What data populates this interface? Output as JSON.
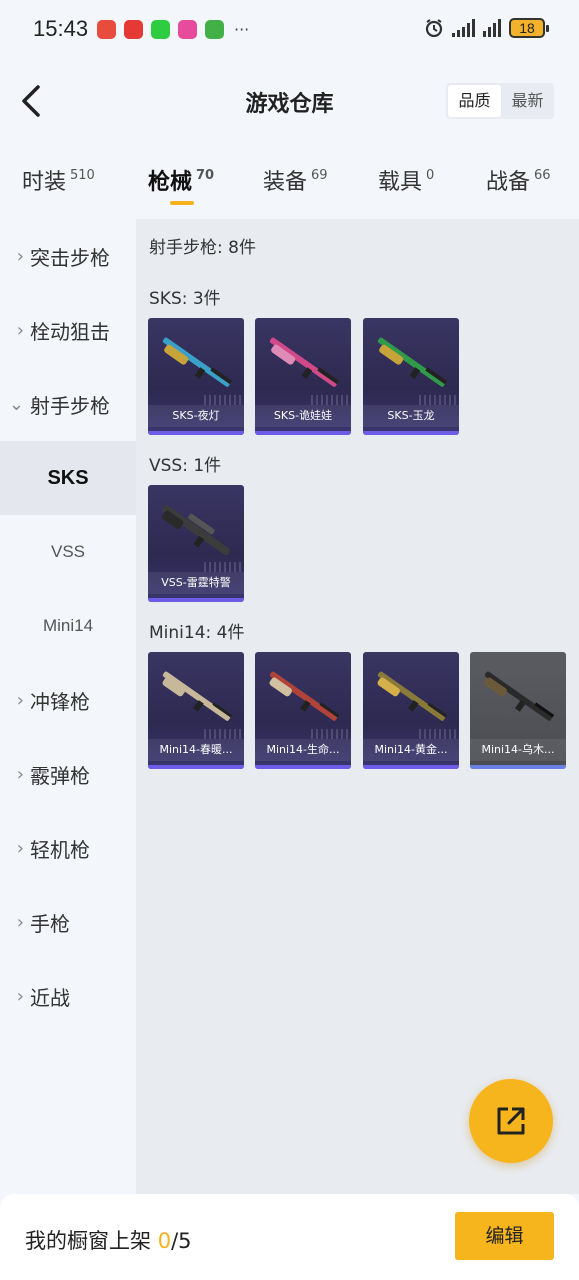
{
  "status_bar": {
    "time": "15:43",
    "app_icon_colors": [
      "#e84c3d",
      "#e53935",
      "#2ecc40",
      "#e74c9c",
      "#43b047"
    ],
    "more": "···",
    "battery": "18"
  },
  "header": {
    "title": "游戏仓库",
    "sort_quality": "品质",
    "sort_latest": "最新"
  },
  "tabs": [
    {
      "label": "时装",
      "count": "510"
    },
    {
      "label": "枪械",
      "count": "70"
    },
    {
      "label": "装备",
      "count": "69"
    },
    {
      "label": "载具",
      "count": "0"
    },
    {
      "label": "战备",
      "count": "66"
    }
  ],
  "sidebar": {
    "categories": {
      "assault": "突击步枪",
      "bolt": "栓动狙击",
      "marksman": "射手步枪",
      "smg": "冲锋枪",
      "shotgun": "霰弹枪",
      "lmg": "轻机枪",
      "pistol": "手枪",
      "melee": "近战"
    },
    "subs": {
      "sks": "SKS",
      "vss": "VSS",
      "mini14": "Mini14"
    }
  },
  "main": {
    "category_title": "射手步枪: 8件",
    "groups": [
      {
        "title": "SKS: 3件",
        "items": [
          "SKS-夜灯",
          "SKS-诡娃娃",
          "SKS-玉龙"
        ]
      },
      {
        "title": "VSS: 1件",
        "items": [
          "VSS-雷霆特警"
        ]
      },
      {
        "title": "Mini14: 4件",
        "items": [
          "Mini14-春暖...",
          "Mini14-生命...",
          "Mini14-黄金...",
          "Mini14-乌木..."
        ]
      }
    ]
  },
  "gun_colors": {
    "sks1": "#3aa0c8",
    "sks2": "#d04a8a",
    "sks3": "#2f9a4a",
    "vss": "#3c3c3c",
    "mini1": "#c8b89a",
    "mini2": "#b0443a",
    "mini3": "#8a7a3a",
    "mini4": "#6b5a3a"
  },
  "bottom_bar": {
    "label": "我的橱窗上架",
    "count": "0",
    "total": "/5",
    "edit": "编辑"
  }
}
